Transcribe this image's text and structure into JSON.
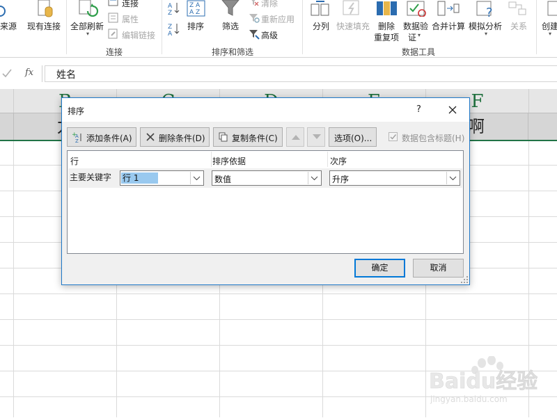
{
  "ribbon": {
    "items": {
      "from_source": "来源",
      "existing_connections": "现有连接",
      "refresh_all": "全部刷新",
      "connections": "连接",
      "properties": "属性",
      "edit_links": "编辑链接",
      "sort": "排序",
      "filter": "筛选",
      "clear": "清除",
      "reapply": "重新应用",
      "advanced": "高级",
      "text_to_columns": "分列",
      "flash_fill": "快速填充",
      "remove_duplicates_1": "删除",
      "remove_duplicates_2": "重复项",
      "data_validation_1": "数据验",
      "data_validation_2": "证",
      "consolidate": "合并计算",
      "what_if": "模拟分析",
      "relationships": "关系",
      "create_group": "创建"
    },
    "groups": {
      "connections": "连接",
      "sort_filter": "排序和筛选",
      "data_tools": "数据工具"
    }
  },
  "formula_bar": {
    "fx": "fx",
    "value": "姓名"
  },
  "sheet": {
    "columns": [
      "B",
      "C",
      "D",
      "E",
      "F"
    ],
    "row1_visible": [
      "力",
      "",
      "",
      "",
      "啊"
    ]
  },
  "dialog": {
    "title": "排序",
    "help": "?",
    "toolbar": {
      "add_level": "添加条件(A)",
      "delete_level": "删除条件(D)",
      "copy_level": "复制条件(C)",
      "options": "选项(O)...",
      "has_headers": "数据包含标题(H)"
    },
    "grid": {
      "headers": {
        "column": "行",
        "sort_on": "排序依据",
        "order": "次序"
      },
      "row": {
        "label": "主要关键字",
        "column_value": "行 1",
        "sort_on_value": "数值",
        "order_value": "升序"
      }
    },
    "ok": "确定",
    "cancel": "取消"
  },
  "watermark": {
    "brand": "Baidu经验",
    "url": "jingyan.baidu.com"
  },
  "colors": {
    "excel_green": "#217346",
    "dialog_border": "#1e78c8",
    "selection_blue": "#99c9ef"
  }
}
